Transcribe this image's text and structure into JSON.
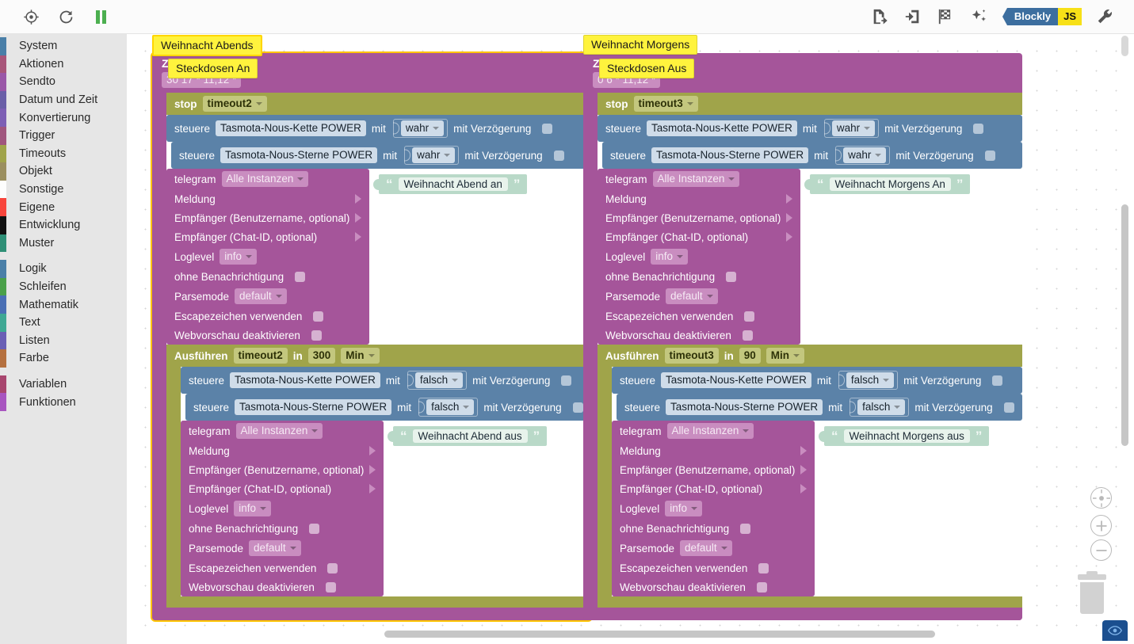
{
  "toolbar": {
    "left_icons": [
      {
        "name": "locate-target-icon",
        "title": "Zentrieren"
      },
      {
        "name": "refresh-icon",
        "title": "Neu laden"
      },
      {
        "name": "pause-icon",
        "title": "Pause"
      }
    ],
    "right_icons": [
      {
        "name": "export-blocks-icon",
        "title": "Exportieren"
      },
      {
        "name": "import-blocks-icon",
        "title": "Importieren"
      },
      {
        "name": "checkered-flag-icon",
        "title": "Start"
      },
      {
        "name": "magic-sparkle-icon",
        "title": "Aufräumen"
      },
      {
        "name": "wrench-icon",
        "title": "Einstellungen"
      }
    ],
    "mode_toggle": {
      "blockly_label": "Blockly",
      "js_label": "JS",
      "blockly_color": "#3c6e9f",
      "js_color": "#f7e017"
    }
  },
  "sidebar": {
    "groups": [
      {
        "items": [
          {
            "label": "System",
            "color": "#4a7fa8"
          },
          {
            "label": "Aktionen",
            "color": "#a8567a"
          },
          {
            "label": "Sendto",
            "color": "#9a57a8"
          },
          {
            "label": "Datum und Zeit",
            "color": "#6a5fa8"
          },
          {
            "label": "Konvertierung",
            "color": "#7d5fb5"
          },
          {
            "label": "Trigger",
            "color": "#a0567e"
          },
          {
            "label": "Timeouts",
            "color": "#a0a44a"
          },
          {
            "label": "Objekt",
            "color": "#9b8f5f"
          },
          {
            "label": "Sonstige",
            "color": "#fdfdfd"
          },
          {
            "label": "Eigene",
            "color": "#f8453c"
          },
          {
            "label": "Entwicklung",
            "color": "#111111"
          },
          {
            "label": "Muster",
            "color": "#2e8f76"
          }
        ]
      },
      {
        "items": [
          {
            "label": "Logik",
            "color": "#4a7fa8"
          },
          {
            "label": "Schleifen",
            "color": "#4aa04a"
          },
          {
            "label": "Mathematik",
            "color": "#4a6fb5"
          },
          {
            "label": "Text",
            "color": "#3fa894"
          },
          {
            "label": "Listen",
            "color": "#6a5fb5"
          },
          {
            "label": "Farbe",
            "color": "#b5703f"
          }
        ]
      },
      {
        "items": [
          {
            "label": "Variablen",
            "color": "#a8466e"
          },
          {
            "label": "Funktionen",
            "color": "#a855c0"
          }
        ]
      }
    ]
  },
  "workspace": {
    "zoom_controls": [
      {
        "name": "zoom-center-button",
        "label": "center"
      },
      {
        "name": "zoom-in-button",
        "label": "+"
      },
      {
        "name": "zoom-out-button",
        "label": "-"
      }
    ],
    "trash_label": "Papierkorb",
    "eye_button_label": "Vorschau"
  },
  "scripts": [
    {
      "id": "weihnacht-abends",
      "title_note": "Weihnacht Abends",
      "schedule": {
        "label": "Zeitplan",
        "cron": "30 17 * 11,12 *"
      },
      "inner_note": "Steckdosen An",
      "stop_timeout": {
        "label": "stop",
        "value": "timeout2"
      },
      "controls_on": [
        {
          "label": "steuere",
          "object": "Tasmota-Nous-Kette POWER",
          "with_label": "mit",
          "value": "wahr",
          "delay_label": "mit Verzögerung",
          "delay_checked": false
        },
        {
          "label": "steuere",
          "object": "Tasmota-Nous-Sterne POWER",
          "with_label": "mit",
          "value": "wahr",
          "delay_label": "mit Verzögerung",
          "delay_checked": false
        }
      ],
      "telegram_on": {
        "label": "telegram",
        "instance": "Alle Instanzen",
        "message_label": "Meldung",
        "message_text": "Weihnacht Abend an",
        "recipient_user_label": "Empfänger (Benutzername, optional)",
        "recipient_chat_label": "Empfänger (Chat-ID, optional)",
        "loglevel_label": "Loglevel",
        "loglevel_value": "info",
        "silent_label": "ohne Benachrichtigung",
        "silent_checked": false,
        "parsemode_label": "Parsemode",
        "parsemode_value": "default",
        "escape_label": "Escapezeichen verwenden",
        "escape_checked": false,
        "nopreview_label": "Webvorschau deaktivieren",
        "nopreview_checked": false
      },
      "delayed": {
        "label": "Ausführen",
        "timer": "timeout2",
        "in_label": "in",
        "amount": "300",
        "unit": "Min"
      },
      "controls_off": [
        {
          "label": "steuere",
          "object": "Tasmota-Nous-Kette POWER",
          "with_label": "mit",
          "value": "falsch",
          "delay_label": "mit Verzögerung",
          "delay_checked": false
        },
        {
          "label": "steuere",
          "object": "Tasmota-Nous-Sterne POWER",
          "with_label": "mit",
          "value": "falsch",
          "delay_label": "mit Verzögerung",
          "delay_checked": false
        }
      ],
      "telegram_off": {
        "label": "telegram",
        "instance": "Alle Instanzen",
        "message_label": "Meldung",
        "message_text": "Weihnacht Abend aus",
        "recipient_user_label": "Empfänger (Benutzername, optional)",
        "recipient_chat_label": "Empfänger (Chat-ID, optional)",
        "loglevel_label": "Loglevel",
        "loglevel_value": "info",
        "silent_label": "ohne Benachrichtigung",
        "silent_checked": false,
        "parsemode_label": "Parsemode",
        "parsemode_value": "default",
        "escape_label": "Escapezeichen verwenden",
        "escape_checked": false,
        "nopreview_label": "Webvorschau deaktivieren",
        "nopreview_checked": false
      }
    },
    {
      "id": "weihnacht-morgens",
      "title_note": "Weihnacht Morgens",
      "schedule": {
        "label": "Zeitplan",
        "cron": "0 6 * 11,12 *"
      },
      "inner_note": "Steckdosen Aus",
      "stop_timeout": {
        "label": "stop",
        "value": "timeout3"
      },
      "controls_on": [
        {
          "label": "steuere",
          "object": "Tasmota-Nous-Kette POWER",
          "with_label": "mit",
          "value": "wahr",
          "delay_label": "mit Verzögerung",
          "delay_checked": false
        },
        {
          "label": "steuere",
          "object": "Tasmota-Nous-Sterne POWER",
          "with_label": "mit",
          "value": "wahr",
          "delay_label": "mit Verzögerung",
          "delay_checked": false
        }
      ],
      "telegram_on": {
        "label": "telegram",
        "instance": "Alle Instanzen",
        "message_label": "Meldung",
        "message_text": "Weihnacht Morgens An",
        "recipient_user_label": "Empfänger (Benutzername, optional)",
        "recipient_chat_label": "Empfänger (Chat-ID, optional)",
        "loglevel_label": "Loglevel",
        "loglevel_value": "info",
        "silent_label": "ohne Benachrichtigung",
        "silent_checked": false,
        "parsemode_label": "Parsemode",
        "parsemode_value": "default",
        "escape_label": "Escapezeichen verwenden",
        "escape_checked": false,
        "nopreview_label": "Webvorschau deaktivieren",
        "nopreview_checked": false
      },
      "delayed": {
        "label": "Ausführen",
        "timer": "timeout3",
        "in_label": "in",
        "amount": "90",
        "unit": "Min"
      },
      "controls_off": [
        {
          "label": "steuere",
          "object": "Tasmota-Nous-Kette POWER",
          "with_label": "mit",
          "value": "falsch",
          "delay_label": "mit Verzögerung",
          "delay_checked": false
        },
        {
          "label": "steuere",
          "object": "Tasmota-Nous-Sterne POWER",
          "with_label": "mit",
          "value": "falsch",
          "delay_label": "mit Verzögerung",
          "delay_checked": false
        }
      ],
      "telegram_off": {
        "label": "telegram",
        "instance": "Alle Instanzen",
        "message_label": "Meldung",
        "message_text": "Weihnacht Morgens aus",
        "recipient_user_label": "Empfänger (Benutzername, optional)",
        "recipient_chat_label": "Empfänger (Chat-ID, optional)",
        "loglevel_label": "Loglevel",
        "loglevel_value": "info",
        "silent_label": "ohne Benachrichtigung",
        "silent_checked": false,
        "parsemode_label": "Parsemode",
        "parsemode_value": "default",
        "escape_label": "Escapezeichen verwenden",
        "escape_checked": false,
        "nopreview_label": "Webvorschau deaktivieren",
        "nopreview_checked": false
      }
    }
  ],
  "colors": {
    "schedule_block": "#a5559a",
    "timeout_block": "#a0a44a",
    "control_block": "#5b82a8",
    "text_block": "#b9d9c8",
    "note": "#fff33d",
    "selection": "#ffc400"
  }
}
